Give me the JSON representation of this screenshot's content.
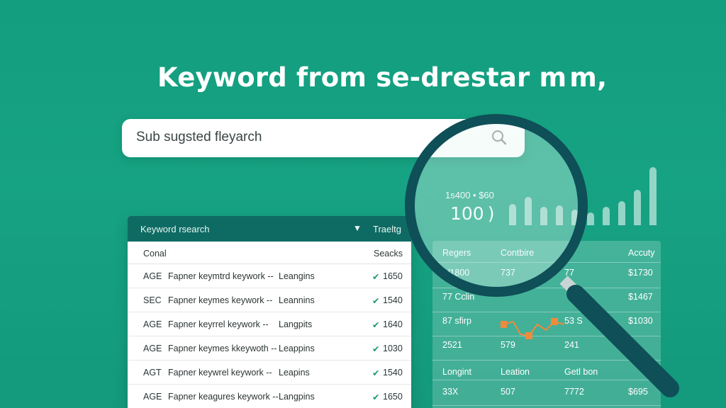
{
  "headline": "Keyword from se-drestar m m,",
  "search": {
    "placeholder": "Sub sugsted fleyarch",
    "icon": "search-icon"
  },
  "table": {
    "title": "Keyword rsearch",
    "caret_icon": "triangle-down-icon",
    "trend_label": "Traeltg",
    "col_left": "Conal",
    "col_right": "Seacks",
    "rows": [
      {
        "code": "AGE",
        "keyword": "Fapner keymtrd keywork --",
        "category": "Leangins",
        "value": "1650"
      },
      {
        "code": "SEC",
        "keyword": "Fapner keymes keywork --",
        "category": "Leannins",
        "value": "1540"
      },
      {
        "code": "AGE",
        "keyword": "Fapner keyrrel keywork --",
        "category": "Langpits",
        "value": "1640"
      },
      {
        "code": "AGE",
        "keyword": "Fapner keymes kkeywoth --",
        "category": "Leappins",
        "value": "1030"
      },
      {
        "code": "AGT",
        "keyword": "Fapner keywrel keywork --",
        "category": "Leapins",
        "value": "1540"
      },
      {
        "code": "AGE",
        "keyword": "Fapner keagures keywork --",
        "category": "Langpins",
        "value": "1650"
      }
    ]
  },
  "chart": {
    "small_stat": "1s400 • $60",
    "big_stat": "100",
    "spark_color": "#f08a3c"
  },
  "panel": {
    "headers": [
      "Regers",
      "Contbire",
      "",
      "Accuty"
    ],
    "rows": [
      [
        "1/1800",
        "737",
        "77",
        "$1730"
      ],
      [
        "77 Cclin",
        "",
        "",
        "$1467"
      ],
      [
        "87 sfirp",
        "",
        "53 S",
        "$1030"
      ],
      [
        "2521",
        "579",
        "241",
        ""
      ]
    ],
    "footer": [
      "Longint",
      "Leation",
      "Getl bon",
      ""
    ],
    "last": [
      "33X",
      "507",
      "7772",
      "$695"
    ]
  },
  "magnifier_icon": "magnifying-glass-icon"
}
